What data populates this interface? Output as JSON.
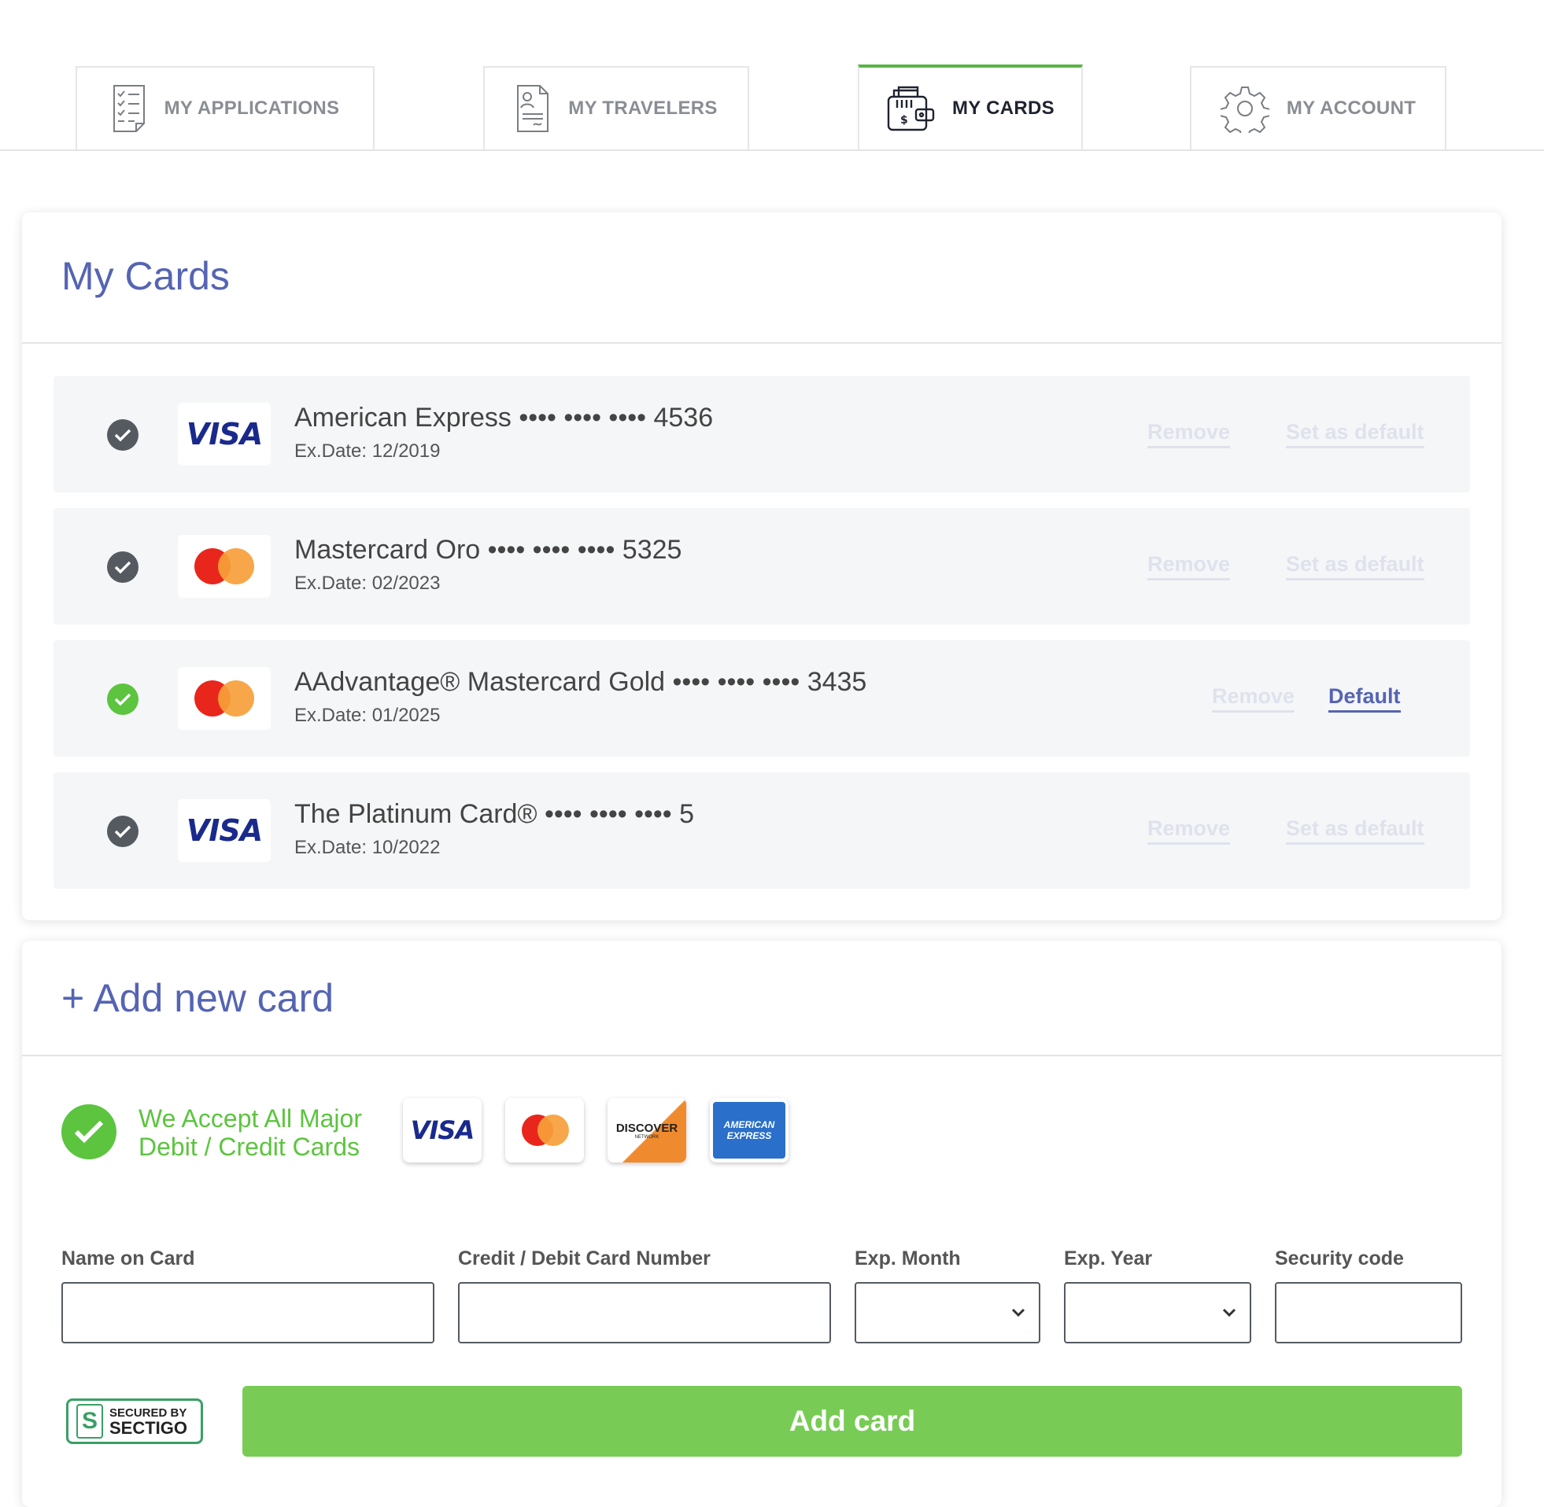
{
  "tabs": [
    {
      "label": "MY APPLICATIONS",
      "icon": "checklist-icon",
      "active": false
    },
    {
      "label": "MY TRAVELERS",
      "icon": "traveler-document-icon",
      "active": false
    },
    {
      "label": "MY CARDS",
      "icon": "wallet-cards-icon",
      "active": true
    },
    {
      "label": "MY ACCOUNT",
      "icon": "gear-icon",
      "active": false
    }
  ],
  "my_cards": {
    "title": "My Cards",
    "cards": [
      {
        "name": "American Express •••• •••• •••• 4536",
        "exp": "Ex.Date: 12/2019",
        "brand": "VISA",
        "remove": "Remove",
        "action": "Set as default",
        "is_default": false
      },
      {
        "name": "Mastercard Oro •••• •••• •••• 5325",
        "exp": "Ex.Date: 02/2023",
        "brand": "mastercard",
        "remove": "Remove",
        "action": "Set as default",
        "is_default": false
      },
      {
        "name": "AAdvantage® Mastercard Gold •••• •••• •••• 3435",
        "exp": "Ex.Date: 01/2025",
        "brand": "mastercard",
        "remove": "Remove",
        "action": "Default",
        "is_default": true
      },
      {
        "name": "The Platinum Card® •••• •••• •••• 5",
        "exp": "Ex.Date: 10/2022",
        "brand": "VISA",
        "remove": "Remove",
        "action": "Set as default",
        "is_default": false
      }
    ]
  },
  "add_card": {
    "title": "+ Add new card",
    "accept_line1": "We Accept All Major",
    "accept_line2": "Debit / Credit Cards",
    "brands": {
      "visa": "VISA",
      "discover": "DISCOVER",
      "discover_sub": "NETWORK",
      "amex_line1": "AMERICAN",
      "amex_line2": "EXPRESS"
    },
    "fields": {
      "name_label": "Name on Card",
      "number_label": "Credit / Debit Card Number",
      "month_label": "Exp. Month",
      "year_label": "Exp. Year",
      "security_label": "Security code"
    },
    "secured_by": "SECURED BY",
    "secured_brand": "SECTIGO",
    "submit_label": "Add card"
  },
  "colors": {
    "accent": "#5564b3",
    "success": "#5cc43f",
    "button": "#78cc55",
    "active_tab": "#5bb346"
  }
}
